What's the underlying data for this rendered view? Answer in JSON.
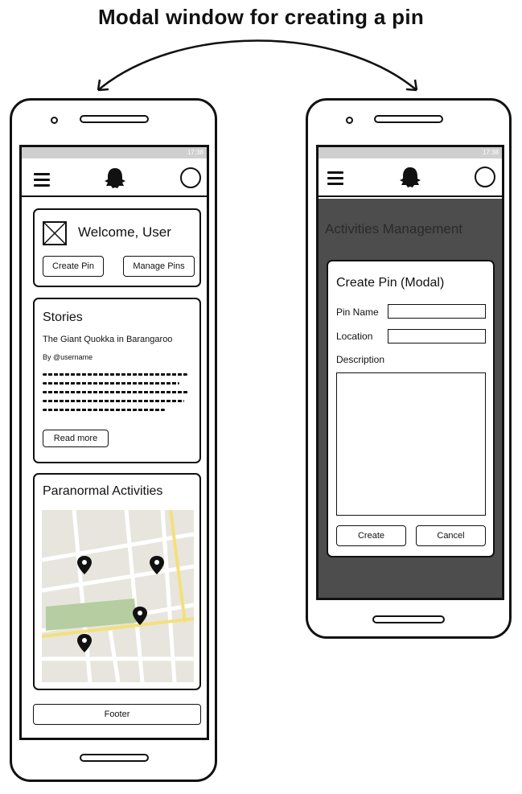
{
  "diagram_title": "Modal window for creating a pin",
  "status_time": "17:38",
  "left_phone": {
    "welcome_text": "Welcome, User",
    "create_pin_btn": "Create Pin",
    "manage_pins_btn": "Manage Pins",
    "stories_heading": "Stories",
    "story_title": "The Giant Quokka in Barangaroo",
    "story_author": "By @username",
    "read_more_btn": "Read more",
    "paranormal_heading": "Paranormal Activities",
    "footer_label": "Footer"
  },
  "right_phone": {
    "page_heading": "Activities Management",
    "modal_title": "Create Pin (Modal)",
    "pin_name_label": "Pin Name",
    "location_label": "Location",
    "description_label": "Description",
    "pin_name_value": "",
    "location_value": "",
    "description_value": "",
    "create_btn": "Create",
    "cancel_btn": "Cancel"
  },
  "colors": {
    "overlay": "#4d4d4d",
    "map_bg": "#e8e5de",
    "park": "#b5cda0",
    "main_road": "#f3e07a",
    "status_bar": "#cfcfcf"
  }
}
